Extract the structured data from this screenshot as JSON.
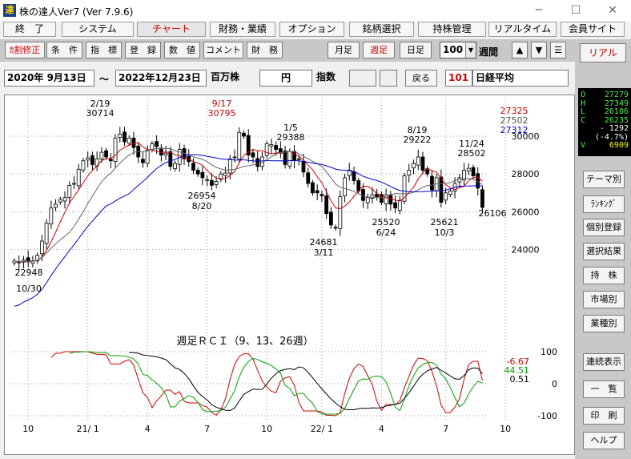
{
  "window": {
    "title": "株の達人Ver7 (Ver 7.9.6)",
    "icon_glyph": "達",
    "minimize": "─",
    "maximize": "☐",
    "close": "✕"
  },
  "menu_tabs": [
    "終　了",
    "システム",
    "チャート",
    "財務・業績",
    "オプション",
    "銘柄選択",
    "持株管理",
    "リアルタイム",
    "会員サイト"
  ],
  "active_tab": "チャート",
  "toolbar": {
    "left_buttons": [
      "ｶ割修正",
      "条　件",
      "指　標",
      "登　録",
      "数　値",
      "コメント",
      "財　務"
    ],
    "periods": [
      "月足",
      "週足",
      "日足"
    ],
    "active_period": "週足",
    "count_value": "100",
    "count_unit": "週間",
    "nav": [
      "▲",
      "▼",
      "☰"
    ]
  },
  "infobar": {
    "date_from": "2020年  9月13日",
    "range_sep": "～",
    "date_to": "2022年12月23日",
    "unit_label": "百万株",
    "currency": "円",
    "index_label": "指数",
    "back_button": "戻る",
    "code": "101",
    "name": "日経平均"
  },
  "right_panel": {
    "real_button": "リアル",
    "quote": [
      {
        "k": "O",
        "v": "27279"
      },
      {
        "k": "H",
        "v": "27349"
      },
      {
        "k": "L",
        "v": "26106"
      },
      {
        "k": "C",
        "v": "26235"
      },
      {
        "k": "",
        "v": "- 1292"
      },
      {
        "k": "",
        "v": "(-4.7%)"
      },
      {
        "k": "V",
        "v": "6909"
      }
    ],
    "buttons": [
      "テーマ別",
      "ﾗﾝｷﾝｸﾞ",
      "個別登録",
      "選択結果",
      "持　株",
      "市場別",
      "業種別",
      "連続表示",
      "一　覧",
      "印　刷",
      "ヘルプ"
    ]
  },
  "chart_data": {
    "type": "candlestick",
    "price_ticks": [
      "30000",
      "28000",
      "26000",
      "24000"
    ],
    "ma_legend": [
      {
        "value": "27325",
        "color": "#d00000"
      },
      {
        "value": "27502",
        "color": "#555555"
      },
      {
        "value": "27312",
        "color": "#0000d0"
      }
    ],
    "annotations": [
      {
        "type": "low",
        "date": "10/30",
        "price": "22948"
      },
      {
        "type": "high",
        "date": "2/19",
        "price": "30714"
      },
      {
        "type": "low",
        "date": "8/20",
        "price": "26954"
      },
      {
        "type": "high",
        "date": "9/17",
        "price": "30795",
        "color": "#d00000"
      },
      {
        "type": "high",
        "date": "1/5",
        "price": "29388"
      },
      {
        "type": "low",
        "date": "3/11",
        "price": "24681"
      },
      {
        "type": "low",
        "date": "6/24",
        "price": "25520"
      },
      {
        "type": "high",
        "date": "8/19",
        "price": "29222"
      },
      {
        "type": "low",
        "date": "10/3",
        "price": "25621"
      },
      {
        "type": "high",
        "date": "11/24",
        "price": "28502"
      },
      {
        "type": "last",
        "price": "26106"
      }
    ],
    "x_ticks": [
      "10",
      "21/ 1",
      "4",
      "7",
      "10",
      "22/ 1",
      "4",
      "7",
      "10"
    ],
    "closes": [
      23400,
      23300,
      23450,
      23350,
      23400,
      23700,
      24450,
      25400,
      26200,
      26400,
      26650,
      26750,
      27400,
      27500,
      28250,
      28700,
      28850,
      28500,
      28800,
      29150,
      28900,
      28700,
      29900,
      30100,
      29700,
      29900,
      29400,
      28900,
      28600,
      29250,
      29600,
      29450,
      29000,
      29100,
      28400,
      28550,
      29300,
      28800,
      28650,
      28200,
      28000,
      27800,
      27700,
      27400,
      27600,
      28000,
      28050,
      28800,
      28900,
      30200,
      30000,
      29000,
      28900,
      28400,
      28900,
      29600,
      29550,
      29300,
      29100,
      28500,
      29200,
      28700,
      28800,
      28100,
      27500,
      27000,
      27000,
      26850,
      25900,
      25300,
      25150,
      26800,
      27800,
      28200,
      27650,
      27100,
      26600,
      26750,
      26900,
      26800,
      26500,
      26900,
      26400,
      26200,
      26600,
      27900,
      28200,
      28550,
      28900,
      28200,
      28000,
      27150,
      27800,
      26500,
      27000,
      27100,
      27500,
      27800,
      28200,
      28300,
      27900,
      27250,
      26235
    ],
    "rci": {
      "title": "週足ＲＣＩ（9、13、26週）",
      "ticks": [
        "100",
        "0",
        "-100"
      ],
      "legend": [
        {
          "name": "9",
          "value": "-6.67",
          "color": "#d00000"
        },
        {
          "name": "13",
          "value": "44.51",
          "color": "#00a000"
        },
        {
          "name": "26",
          "value": "0.51",
          "color": "#000000"
        }
      ]
    }
  }
}
